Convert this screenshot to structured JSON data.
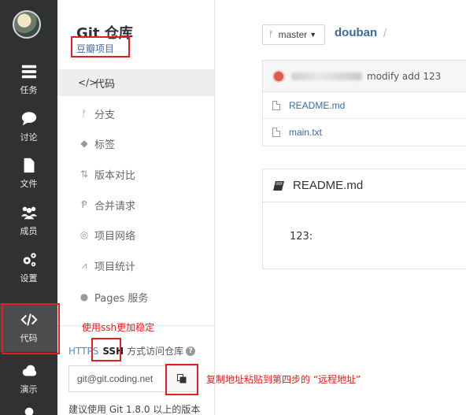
{
  "rail": {
    "items": [
      {
        "label": "任务",
        "icon": "list-icon"
      },
      {
        "label": "讨论",
        "icon": "chat-icon"
      },
      {
        "label": "文件",
        "icon": "file-icon"
      },
      {
        "label": "成员",
        "icon": "members-icon"
      },
      {
        "label": "设置",
        "icon": "gears-icon"
      },
      {
        "label": "代码",
        "icon": "code-icon"
      },
      {
        "label": "演示",
        "icon": "cloud-icon"
      }
    ],
    "active": "代码"
  },
  "subnav": {
    "title": "Git 仓库",
    "project": "豆瓣项目",
    "items": [
      {
        "label": "代码",
        "icon": "code-icon"
      },
      {
        "label": "分支",
        "icon": "branch-icon"
      },
      {
        "label": "标签",
        "icon": "tag-icon"
      },
      {
        "label": "版本对比",
        "icon": "compare-icon"
      },
      {
        "label": "合并请求",
        "icon": "merge-request-icon"
      },
      {
        "label": "项目网络",
        "icon": "network-icon"
      },
      {
        "label": "项目统计",
        "icon": "stats-icon"
      },
      {
        "label": "Pages 服务",
        "icon": "pages-icon"
      }
    ],
    "protocol": {
      "https": "HTTPS",
      "ssh": "SSH",
      "description": "方式访问仓库"
    },
    "clone_url": "git@git.coding.net",
    "git_tip": "建议使用 Git 1.8.0 以上的版本"
  },
  "main": {
    "branch": "master",
    "repo": "douban",
    "separator": "/",
    "commit_message": "modify add 123",
    "files": [
      "README.md",
      "main.txt"
    ],
    "readme": {
      "title": "README.md",
      "content": "123:"
    }
  },
  "annotations": {
    "ssh_note": "使用ssh更加稳定",
    "copy_note": "复制地址粘贴到第四步的 “远程地址”"
  },
  "colors": {
    "rail_bg": "#2f3133",
    "link": "#3b6a9e",
    "annotation": "#e0201c"
  }
}
